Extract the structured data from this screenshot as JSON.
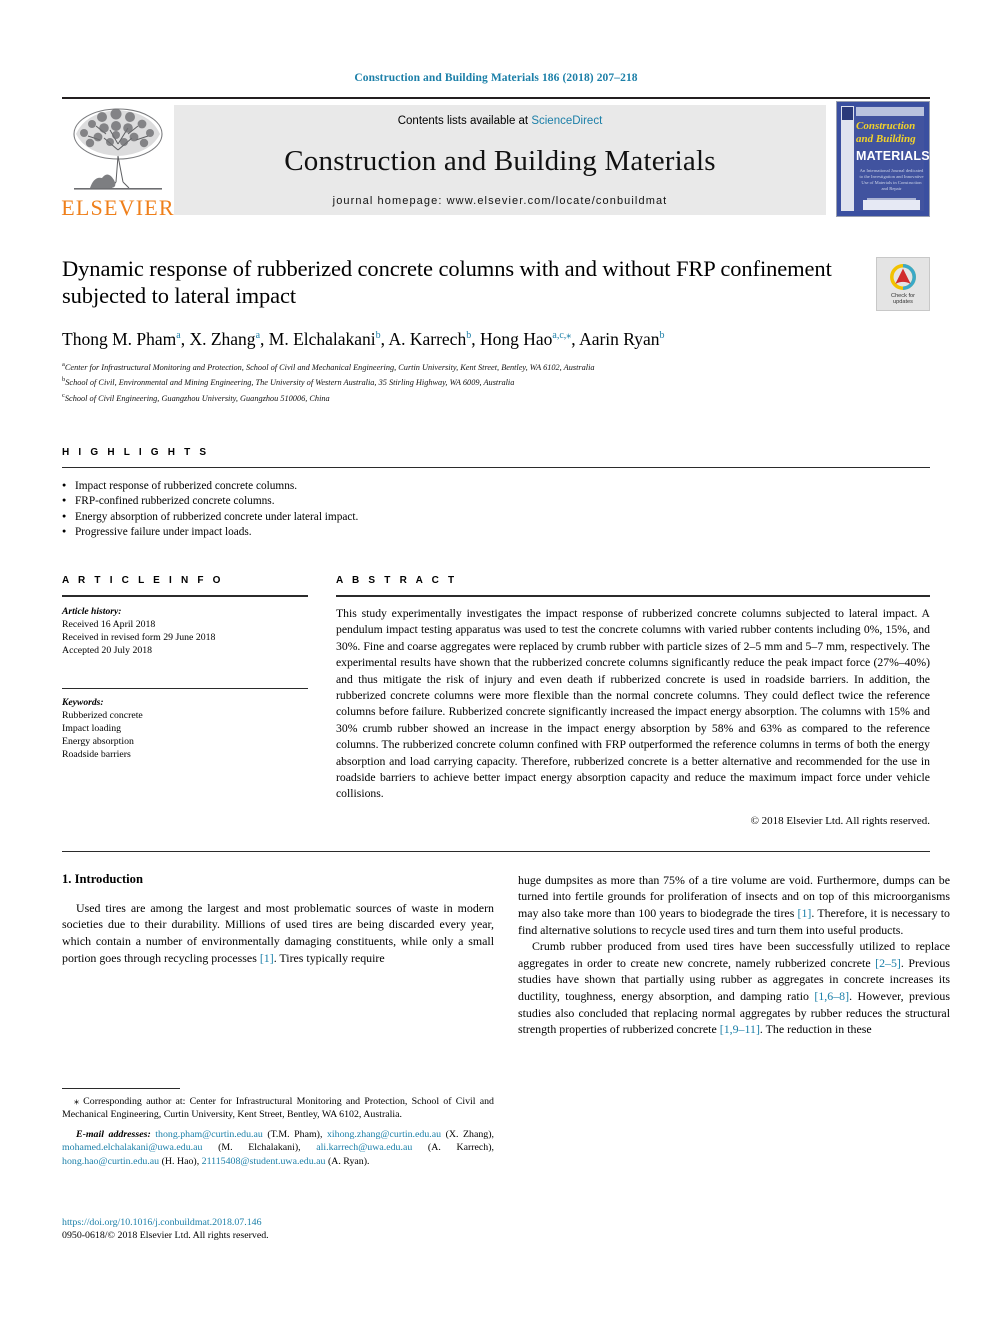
{
  "running_head": "Construction and Building Materials 186 (2018) 207–218",
  "masthead": {
    "contents_prefix": "Contents lists available at ",
    "sciencedirect": "ScienceDirect",
    "journal_name": "Construction and Building Materials",
    "homepage": "journal homepage: www.elsevier.com/locate/conbuildmat",
    "publisher_wordmark": "ELSEVIER",
    "cover": {
      "title_line1": "Construction",
      "title_line2": "and Building",
      "title_line3": "MATERIALS",
      "subtitle": "An International Journal dedicated to the Investigation and Innovative Use of Materials in Construction and Repair"
    },
    "accent_link_color": "#1b7fa8",
    "elsevier_orange": "#ef7f1a"
  },
  "title": {
    "text": "Dynamic response of rubberized concrete columns with and without FRP confinement subjected to lateral impact",
    "crossmark_label_line1": "Check for",
    "crossmark_label_line2": "updates"
  },
  "authors": [
    {
      "name": "Thong M. Pham",
      "sup": "a",
      "sep": ", "
    },
    {
      "name": "X. Zhang",
      "sup": "a",
      "sep": ", "
    },
    {
      "name": "M. Elchalakani",
      "sup": "b",
      "sep": ", "
    },
    {
      "name": "A. Karrech",
      "sup": "b",
      "sep": ", "
    },
    {
      "name": "Hong Hao",
      "sup": "a,c,⁎",
      "sep": ", "
    },
    {
      "name": "Aarin Ryan",
      "sup": "b",
      "sep": ""
    }
  ],
  "affiliations": [
    {
      "sup": "a",
      "text": "Center for Infrastructural Monitoring and Protection, School of Civil and Mechanical Engineering, Curtin University, Kent Street, Bentley, WA 6102, Australia"
    },
    {
      "sup": "b",
      "text": "School of Civil, Environmental and Mining Engineering, The University of Western Australia, 35 Stirling Highway, WA 6009, Australia"
    },
    {
      "sup": "c",
      "text": "School of Civil Engineering, Guangzhou University, Guangzhou 510006, China"
    }
  ],
  "highlights": {
    "heading": "H I G H L I G H T S",
    "items": [
      "Impact response of rubberized concrete columns.",
      "FRP-confined rubberized concrete columns.",
      "Energy absorption of rubberized concrete under lateral impact.",
      "Progressive failure under impact loads."
    ]
  },
  "article_info": {
    "heading": "A R T I C L E   I N F O",
    "history_label": "Article history:",
    "history": [
      "Received 16 April 2018",
      "Received in revised form 29 June 2018",
      "Accepted 20 July 2018"
    ],
    "keywords_label": "Keywords:",
    "keywords": [
      "Rubberized concrete",
      "Impact loading",
      "Energy absorption",
      "Roadside barriers"
    ]
  },
  "abstract": {
    "heading": "A B S T R A C T",
    "text": "This study experimentally investigates the impact response of rubberized concrete columns subjected to lateral impact. A pendulum impact testing apparatus was used to test the concrete columns with varied rubber contents including 0%, 15%, and 30%. Fine and coarse aggregates were replaced by crumb rubber with particle sizes of 2–5 mm and 5–7 mm, respectively. The experimental results have shown that the rubberized concrete columns significantly reduce the peak impact force (27%–40%) and thus mitigate the risk of injury and even death if rubberized concrete is used in roadside barriers. In addition, the rubberized concrete columns were more flexible than the normal concrete columns. They could deflect twice the reference columns before failure. Rubberized concrete significantly increased the impact energy absorption. The columns with 15% and 30% crumb rubber showed an increase in the impact energy absorption by 58% and 63% as compared to the reference columns. The rubberized concrete column confined with FRP outperformed the reference columns in terms of both the energy absorption and load carrying capacity. Therefore, rubberized concrete is a better alternative and recommended for the use in roadside barriers to achieve better impact energy absorption capacity and reduce the maximum impact force under vehicle collisions.",
    "copyright": "© 2018 Elsevier Ltd. All rights reserved."
  },
  "introduction": {
    "section_number_title": "1. Introduction",
    "left_paragraph_1_a": "Used tires are among the largest and most problematic sources of waste in modern societies due to their durability. Millions of used tires are being discarded every year, which contain a number of environmentally damaging constituents, while only a small portion goes through recycling processes ",
    "left_ref_1": "[1]",
    "left_paragraph_1_b": ". Tires typically require",
    "right_paragraph_1_a": "huge dumpsites as more than 75% of a tire volume are void. Furthermore, dumps can be turned into fertile grounds for proliferation of insects and on top of this microorganisms may also take more than 100 years to biodegrade the tires ",
    "right_ref_1": "[1]",
    "right_paragraph_1_b": ". Therefore, it is necessary to find alternative solutions to recycle used tires and turn them into useful products.",
    "right_paragraph_2_a": "Crumb rubber produced from used tires have been successfully utilized to replace aggregates in order to create new concrete, namely rubberized concrete ",
    "right_ref_2": "[2–5]",
    "right_paragraph_2_b": ". Previous studies have shown that partially using rubber as aggregates in concrete increases its ductility, toughness, energy absorption, and damping ratio ",
    "right_ref_3": "[1,6–8]",
    "right_paragraph_2_c": ". However, previous studies also concluded that replacing normal aggregates by rubber reduces the structural strength properties of rubberized concrete ",
    "right_ref_4": "[1,9–11]",
    "right_paragraph_2_d": ". The reduction in these"
  },
  "footnote": {
    "star": "⁎",
    "corresponding": " Corresponding author at: Center for Infrastructural Monitoring and Protection, School of Civil and Mechanical Engineering, Curtin University, Kent Street, Bentley, WA 6102, Australia.",
    "email_label": "E-mail addresses:",
    "emails": [
      {
        "address": "thong.pham@curtin.edu.au",
        "person": " (T.M. Pham), "
      },
      {
        "address": "xihong.zhang@curtin.edu.au",
        "person": " (X. Zhang), "
      },
      {
        "address": "mohamed.elchalakani@uwa.edu.au",
        "person": " (M. Elchalakani), "
      },
      {
        "address": "ali.karrech@uwa.edu.au",
        "person": " (A. Karrech), "
      },
      {
        "address": "hong.hao@curtin.edu.au",
        "person": " (H. Hao), "
      },
      {
        "address": "21115408@student.uwa.edu.au",
        "person": " (A. Ryan)."
      }
    ]
  },
  "bottom": {
    "doi": "https://doi.org/10.1016/j.conbuildmat.2018.07.146",
    "issn_copyright": "0950-0618/© 2018 Elsevier Ltd. All rights reserved."
  }
}
